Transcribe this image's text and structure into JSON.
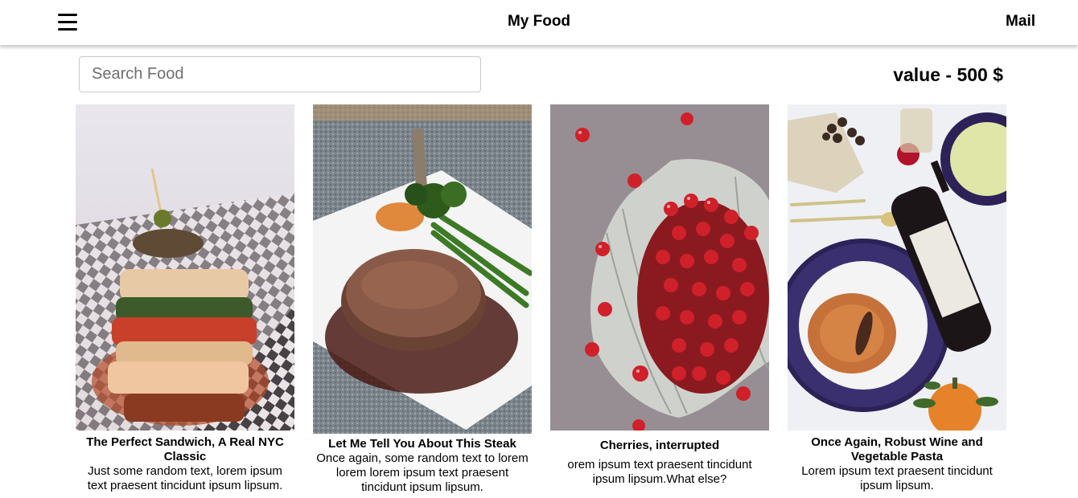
{
  "header": {
    "menu_icon": "hamburger-menu-icon",
    "title": "My Food",
    "mail_label": "Mail"
  },
  "search": {
    "placeholder": "Search Food",
    "value": ""
  },
  "summary": {
    "value_text": "value - 500 $"
  },
  "cards": [
    {
      "title": "The Perfect Sandwich, A Real NYC Classic",
      "text": "Just some random text, lorem ipsum text praesent tincidunt ipsum lipsum.",
      "image": "sandwich-photo"
    },
    {
      "title": "Let Me Tell You About This Steak",
      "text": "Once again, some random text to lorem lorem lorem ipsum text praesent tincidunt ipsum lipsum.",
      "image": "steak-photo"
    },
    {
      "title": "Cherries, interrupted",
      "text": "orem ipsum text praesent tincidunt ipsum lipsum.What else?",
      "image": "cherries-photo"
    },
    {
      "title": "Once Again, Robust Wine and Vegetable Pasta",
      "text": "Lorem ipsum text praesent tincidunt ipsum lipsum.",
      "image": "wine-pasta-photo"
    }
  ]
}
